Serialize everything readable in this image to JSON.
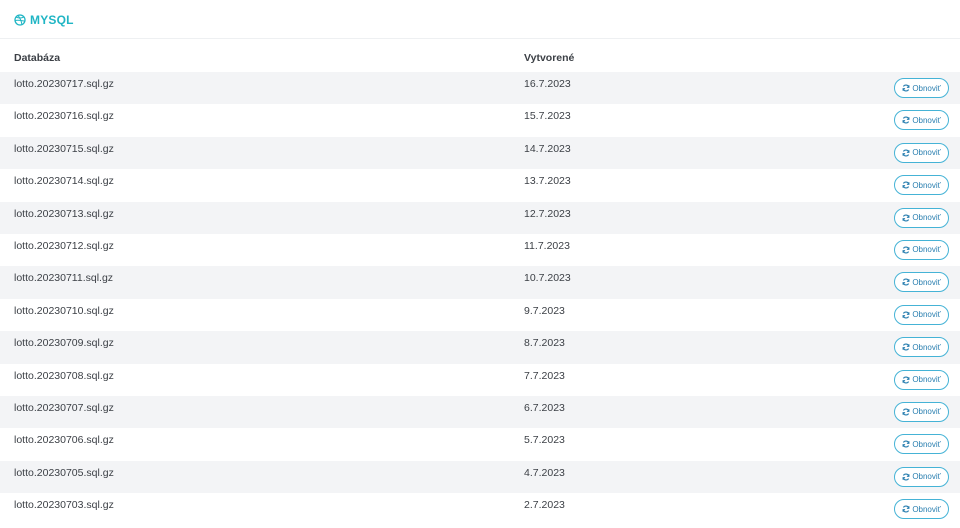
{
  "section": {
    "title": "MYSQL",
    "icon": "dribbble-icon",
    "accent": "#1fb5c4"
  },
  "table": {
    "columns": {
      "database": "Databáza",
      "created": "Vytvorené"
    },
    "restore_label": "Obnoviť",
    "rows": [
      {
        "database": "lotto.20230717.sql.gz",
        "created": "16.7.2023"
      },
      {
        "database": "lotto.20230716.sql.gz",
        "created": "15.7.2023"
      },
      {
        "database": "lotto.20230715.sql.gz",
        "created": "14.7.2023"
      },
      {
        "database": "lotto.20230714.sql.gz",
        "created": "13.7.2023"
      },
      {
        "database": "lotto.20230713.sql.gz",
        "created": "12.7.2023"
      },
      {
        "database": "lotto.20230712.sql.gz",
        "created": "11.7.2023"
      },
      {
        "database": "lotto.20230711.sql.gz",
        "created": "10.7.2023"
      },
      {
        "database": "lotto.20230710.sql.gz",
        "created": "9.7.2023"
      },
      {
        "database": "lotto.20230709.sql.gz",
        "created": "8.7.2023"
      },
      {
        "database": "lotto.20230708.sql.gz",
        "created": "7.7.2023"
      },
      {
        "database": "lotto.20230707.sql.gz",
        "created": "6.7.2023"
      },
      {
        "database": "lotto.20230706.sql.gz",
        "created": "5.7.2023"
      },
      {
        "database": "lotto.20230705.sql.gz",
        "created": "4.7.2023"
      },
      {
        "database": "lotto.20230703.sql.gz",
        "created": "2.7.2023"
      }
    ]
  }
}
